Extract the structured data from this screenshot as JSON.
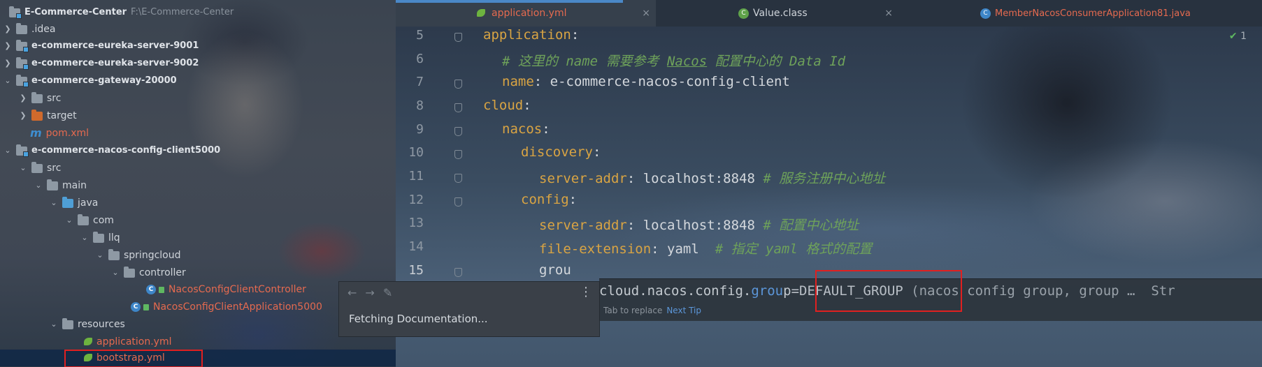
{
  "project": {
    "items": [
      {
        "label": "E-Commerce-Center",
        "path": "F:\\E-Commerce-Center"
      },
      {
        "label": ".idea"
      },
      {
        "label": "e-commerce-eureka-server-9001"
      },
      {
        "label": "e-commerce-eureka-server-9002"
      },
      {
        "label": "e-commerce-gateway-20000"
      },
      {
        "label": "src"
      },
      {
        "label": "target"
      },
      {
        "label": "pom.xml"
      },
      {
        "label": "e-commerce-nacos-config-client5000"
      },
      {
        "label": "src"
      },
      {
        "label": "main"
      },
      {
        "label": "java"
      },
      {
        "label": "com"
      },
      {
        "label": "llq"
      },
      {
        "label": "springcloud"
      },
      {
        "label": "controller"
      },
      {
        "label": "NacosConfigClientController"
      },
      {
        "label": "NacosConfigClientApplication5000"
      },
      {
        "label": "resources"
      },
      {
        "label": "application.yml"
      },
      {
        "label": "bootstrap.yml"
      }
    ]
  },
  "tabs": [
    {
      "label": "application.yml",
      "close": "×"
    },
    {
      "label": "Value.class",
      "close": "×"
    },
    {
      "label": "MemberNacosConsumerApplication81.java"
    }
  ],
  "editor": {
    "inspection_count": "1",
    "lines": [
      {
        "num": "5",
        "key": "application",
        "colon": ":",
        "value": "",
        "comment": ""
      },
      {
        "num": "6",
        "comment_pre": "# 这里的 name 需要参考 ",
        "comment_link": "Nacos",
        "comment_post": " 配置中心的 Data Id"
      },
      {
        "num": "7",
        "key": "name",
        "colon": ":",
        "value": " e-commerce-nacos-config-client"
      },
      {
        "num": "8",
        "key": "cloud",
        "colon": ":"
      },
      {
        "num": "9",
        "key": "nacos",
        "colon": ":"
      },
      {
        "num": "10",
        "key": "discovery",
        "colon": ":"
      },
      {
        "num": "11",
        "key": "server-addr",
        "colon": ":",
        "value": " localhost:8848 ",
        "comment": "# 服务注册中心地址"
      },
      {
        "num": "12",
        "key": "config",
        "colon": ":"
      },
      {
        "num": "13",
        "key": "server-addr",
        "colon": ":",
        "value": " localhost:8848 ",
        "comment": "# 配置中心地址"
      },
      {
        "num": "14",
        "key": "file-extension",
        "colon": ":",
        "value": " yaml  ",
        "comment": "# 指定 yaml 格式的配置"
      },
      {
        "num": "15",
        "value": "grou"
      }
    ]
  },
  "completion": {
    "prefix": "cloud.nacos.config.",
    "match": "grou",
    "rest": "p",
    "value": "=DEFAULT_GROUP",
    "desc": " (nacos config group, group …  Str",
    "hint": "Tab to replace",
    "next_tip": "Next Tip"
  },
  "doc_popup": {
    "back_glyph": "←",
    "forward_glyph": "→",
    "edit_glyph": "✎",
    "menu_glyph": "⋮",
    "message": "Fetching Documentation..."
  }
}
